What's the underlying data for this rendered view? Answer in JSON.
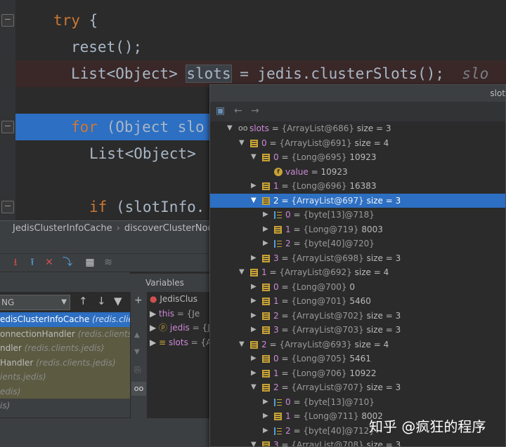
{
  "editor": {
    "lines": [
      {
        "kw": "try",
        "text": " {"
      },
      {
        "text": "reset();"
      },
      {
        "prefix": "List<Object> ",
        "highlight": "slots",
        "rest": " = jedis.clusterSlots();",
        "comment": "slo"
      },
      {
        "kw": "for",
        "text": " (Object slo"
      },
      {
        "text": "List<Object>"
      },
      {
        "kw": "if",
        "text": " (slotInfo."
      }
    ]
  },
  "breadcrumb": {
    "items": [
      "JedisClusterInfoCache",
      "discoverClusterNodesA"
    ],
    "separator": "›"
  },
  "debugger": {
    "thread_select": "NG",
    "variables_label": "Variables",
    "frames": [
      {
        "method": "edisClusterInfoCache",
        "pkg": "(redis.client"
      },
      {
        "method": "onnectionHandler",
        "pkg": "(redis.clients.je"
      },
      {
        "method": "ndler",
        "pkg": "(redis.clients.jedis)"
      },
      {
        "method": "Handler",
        "pkg": "(redis.clients.jedis)"
      },
      {
        "method": "",
        "pkg": "ients.jedis)"
      },
      {
        "method": "",
        "pkg": "edis)"
      },
      {
        "method": "",
        "pkg": "is)"
      }
    ],
    "variables_mini": [
      {
        "name": "JedisClus"
      },
      {
        "name": "this",
        "rest": "= {Je"
      },
      {
        "name": "jedis",
        "rest": "= {J"
      },
      {
        "name": "slots",
        "rest": "= {A"
      }
    ]
  },
  "popup": {
    "title": "slot",
    "tree": [
      {
        "level": 0,
        "arrow": "▼",
        "icon": "oo",
        "name": "slots",
        "type": "{ArrayList@686}",
        "extra": "size = 3"
      },
      {
        "level": 1,
        "arrow": "▼",
        "icon": "list",
        "name": "0",
        "type": "{ArrayList@691}",
        "extra": "size = 4"
      },
      {
        "level": 2,
        "arrow": "▼",
        "icon": "list",
        "name": "0",
        "type": "{Long@695}",
        "extra": "10923"
      },
      {
        "level": 3,
        "arrow": "",
        "icon": "field",
        "name": "value",
        "type": "",
        "extra": "10923"
      },
      {
        "level": 2,
        "arrow": "▶",
        "icon": "list",
        "name": "1",
        "type": "{Long@696}",
        "extra": "16383"
      },
      {
        "level": 2,
        "arrow": "▼",
        "icon": "list",
        "name": "2",
        "type": "{ArrayList@697}",
        "extra": "size = 3",
        "selected": true
      },
      {
        "level": 3,
        "arrow": "▶",
        "icon": "arr",
        "name": "0",
        "type": "{byte[13]@718}",
        "extra": ""
      },
      {
        "level": 3,
        "arrow": "▶",
        "icon": "list",
        "name": "1",
        "type": "{Long@719}",
        "extra": "8003"
      },
      {
        "level": 3,
        "arrow": "▶",
        "icon": "arr",
        "name": "2",
        "type": "{byte[40]@720}",
        "extra": ""
      },
      {
        "level": 2,
        "arrow": "▶",
        "icon": "list",
        "name": "3",
        "type": "{ArrayList@698}",
        "extra": "size = 3"
      },
      {
        "level": 1,
        "arrow": "▼",
        "icon": "list",
        "name": "1",
        "type": "{ArrayList@692}",
        "extra": "size = 4"
      },
      {
        "level": 2,
        "arrow": "▶",
        "icon": "list",
        "name": "0",
        "type": "{Long@700}",
        "extra": "0"
      },
      {
        "level": 2,
        "arrow": "▶",
        "icon": "list",
        "name": "1",
        "type": "{Long@701}",
        "extra": "5460"
      },
      {
        "level": 2,
        "arrow": "▶",
        "icon": "list",
        "name": "2",
        "type": "{ArrayList@702}",
        "extra": "size = 3"
      },
      {
        "level": 2,
        "arrow": "▶",
        "icon": "list",
        "name": "3",
        "type": "{ArrayList@703}",
        "extra": "size = 3"
      },
      {
        "level": 1,
        "arrow": "▼",
        "icon": "list",
        "name": "2",
        "type": "{ArrayList@693}",
        "extra": "size = 4"
      },
      {
        "level": 2,
        "arrow": "▶",
        "icon": "list",
        "name": "0",
        "type": "{Long@705}",
        "extra": "5461"
      },
      {
        "level": 2,
        "arrow": "▶",
        "icon": "list",
        "name": "1",
        "type": "{Long@706}",
        "extra": "10922"
      },
      {
        "level": 2,
        "arrow": "▼",
        "icon": "list",
        "name": "2",
        "type": "{ArrayList@707}",
        "extra": "size = 3"
      },
      {
        "level": 3,
        "arrow": "▶",
        "icon": "arr",
        "name": "0",
        "type": "{byte[13]@710}",
        "extra": ""
      },
      {
        "level": 3,
        "arrow": "▶",
        "icon": "list",
        "name": "1",
        "type": "{Long@711}",
        "extra": "8002"
      },
      {
        "level": 3,
        "arrow": "▶",
        "icon": "arr",
        "name": "2",
        "type": "{byte[40]@712}",
        "extra": ""
      },
      {
        "level": 2,
        "arrow": "▼",
        "icon": "list",
        "name": "3",
        "type": "{ArrayList@708}",
        "extra": "size = 3"
      }
    ]
  },
  "watermark": "知乎 @疯狂的程序",
  "colors": {
    "keyword": "#cc7832",
    "selection": "#2d6fc2",
    "var_name": "#cc8ad7",
    "editor_bg": "#2b2b2b"
  }
}
